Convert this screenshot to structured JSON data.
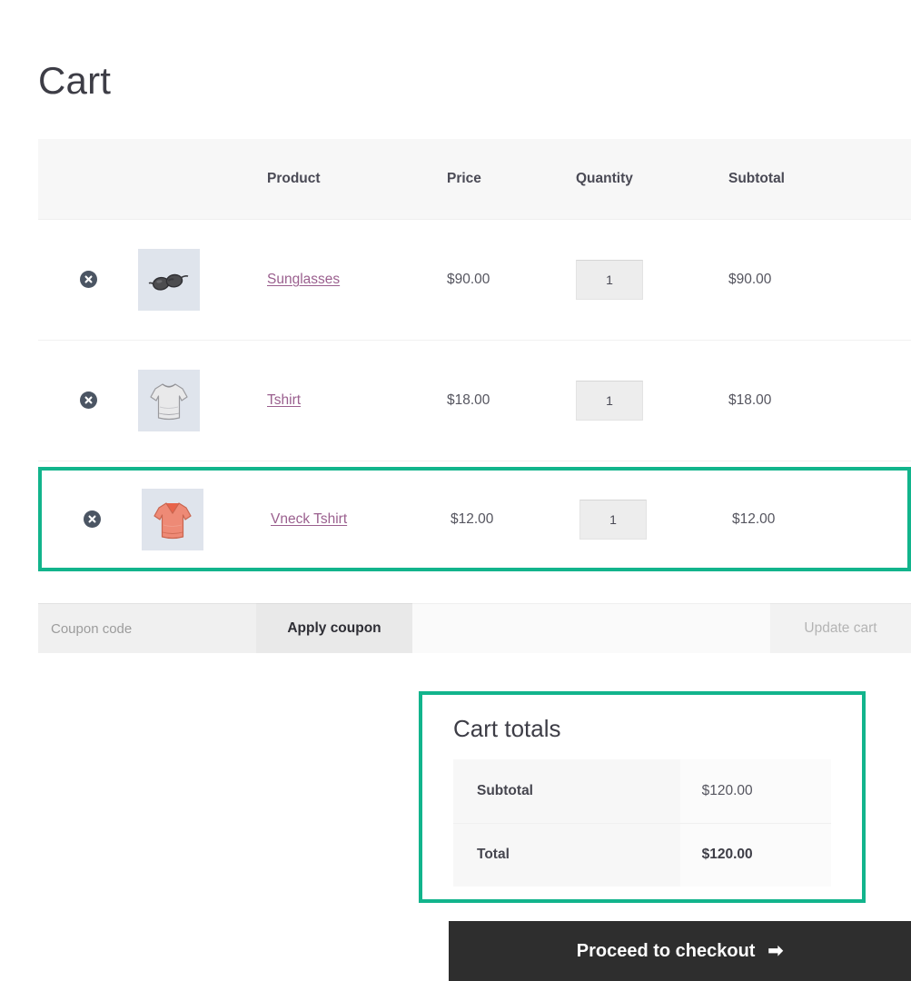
{
  "page": {
    "title": "Cart"
  },
  "table": {
    "headers": {
      "remove": "",
      "thumbnail": "",
      "product": "Product",
      "price": "Price",
      "quantity": "Quantity",
      "subtotal": "Subtotal"
    },
    "rows": [
      {
        "remove_icon": "remove-item-icon",
        "thumb_icon": "sunglasses-thumbnail",
        "product": "Sunglasses",
        "price": "$90.00",
        "quantity": "1",
        "subtotal": "$90.00",
        "highlighted": false
      },
      {
        "remove_icon": "remove-item-icon",
        "thumb_icon": "tshirt-thumbnail",
        "product": "Tshirt",
        "price": "$18.00",
        "quantity": "1",
        "subtotal": "$18.00",
        "highlighted": false
      },
      {
        "remove_icon": "remove-item-icon",
        "thumb_icon": "vneck-tshirt-thumbnail",
        "product": "Vneck Tshirt",
        "price": "$12.00",
        "quantity": "1",
        "subtotal": "$12.00",
        "highlighted": true
      }
    ]
  },
  "actions": {
    "coupon_placeholder": "Coupon code",
    "coupon_value": "",
    "apply_label": "Apply coupon",
    "update_label": "Update cart"
  },
  "totals": {
    "title": "Cart totals",
    "rows": [
      {
        "label": "Subtotal",
        "value": "$120.00",
        "strong": false
      },
      {
        "label": "Total",
        "value": "$120.00",
        "strong": true
      }
    ]
  },
  "checkout": {
    "label": "Proceed to checkout",
    "arrow": "➡"
  },
  "colors": {
    "highlight": "#12b48c",
    "link": "#9a5f8e",
    "checkout_bg": "#2e2e2e",
    "header_bg": "#f7f7f7",
    "thumb_bg": "#dfe4ec"
  }
}
